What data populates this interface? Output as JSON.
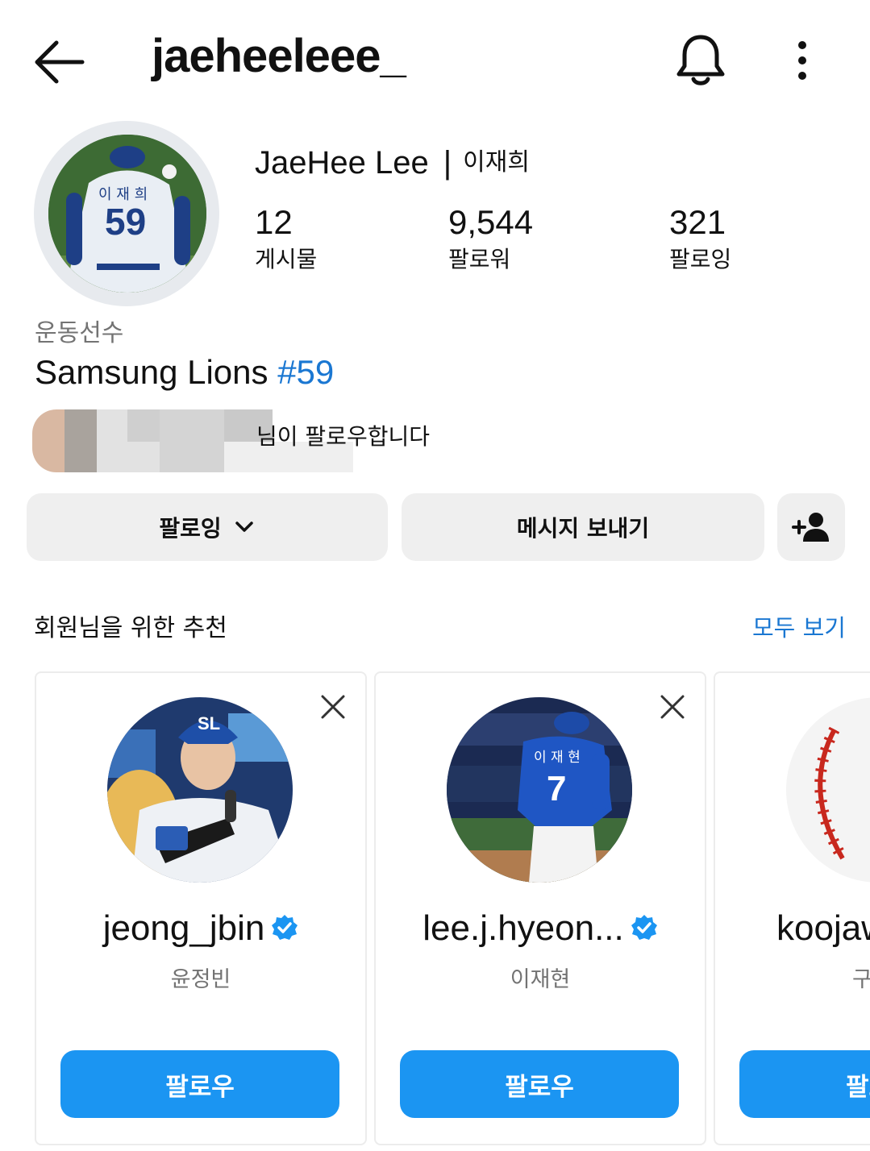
{
  "header": {
    "username": "jaeheeleee_"
  },
  "profile": {
    "display_name": "JaeHee Lee",
    "separator": "|",
    "korean_name": "이재희",
    "stats": [
      {
        "value": "12",
        "label": "게시물"
      },
      {
        "value": "9,544",
        "label": "팔로워"
      },
      {
        "value": "321",
        "label": "팔로잉"
      }
    ],
    "category": "운동선수",
    "bio_text": "Samsung Lions ",
    "bio_hashtag": "#59",
    "followed_by_text": "님이 팔로우합니다",
    "jersey_name": "이 재 희",
    "jersey_number": "59"
  },
  "actions": {
    "following_label": "팔로잉",
    "message_label": "메시지 보내기"
  },
  "suggestions": {
    "title": "회원님을 위한 추천",
    "see_all": "모두 보기",
    "cards": [
      {
        "username": "jeong_jbin",
        "name": "윤정빈",
        "follow": "팔로우",
        "verified": true
      },
      {
        "username": "lee.j.hyeon...",
        "name": "이재현",
        "follow": "팔로우",
        "verified": true,
        "jersey_name": "이 재 현",
        "jersey_number": "7"
      },
      {
        "username": "koojaw",
        "name": "구",
        "follow": "팔로우"
      }
    ]
  },
  "colors": {
    "accent": "#1b95f2",
    "link": "#1a77d2",
    "muted": "#737373",
    "button_grey": "#efefef"
  }
}
